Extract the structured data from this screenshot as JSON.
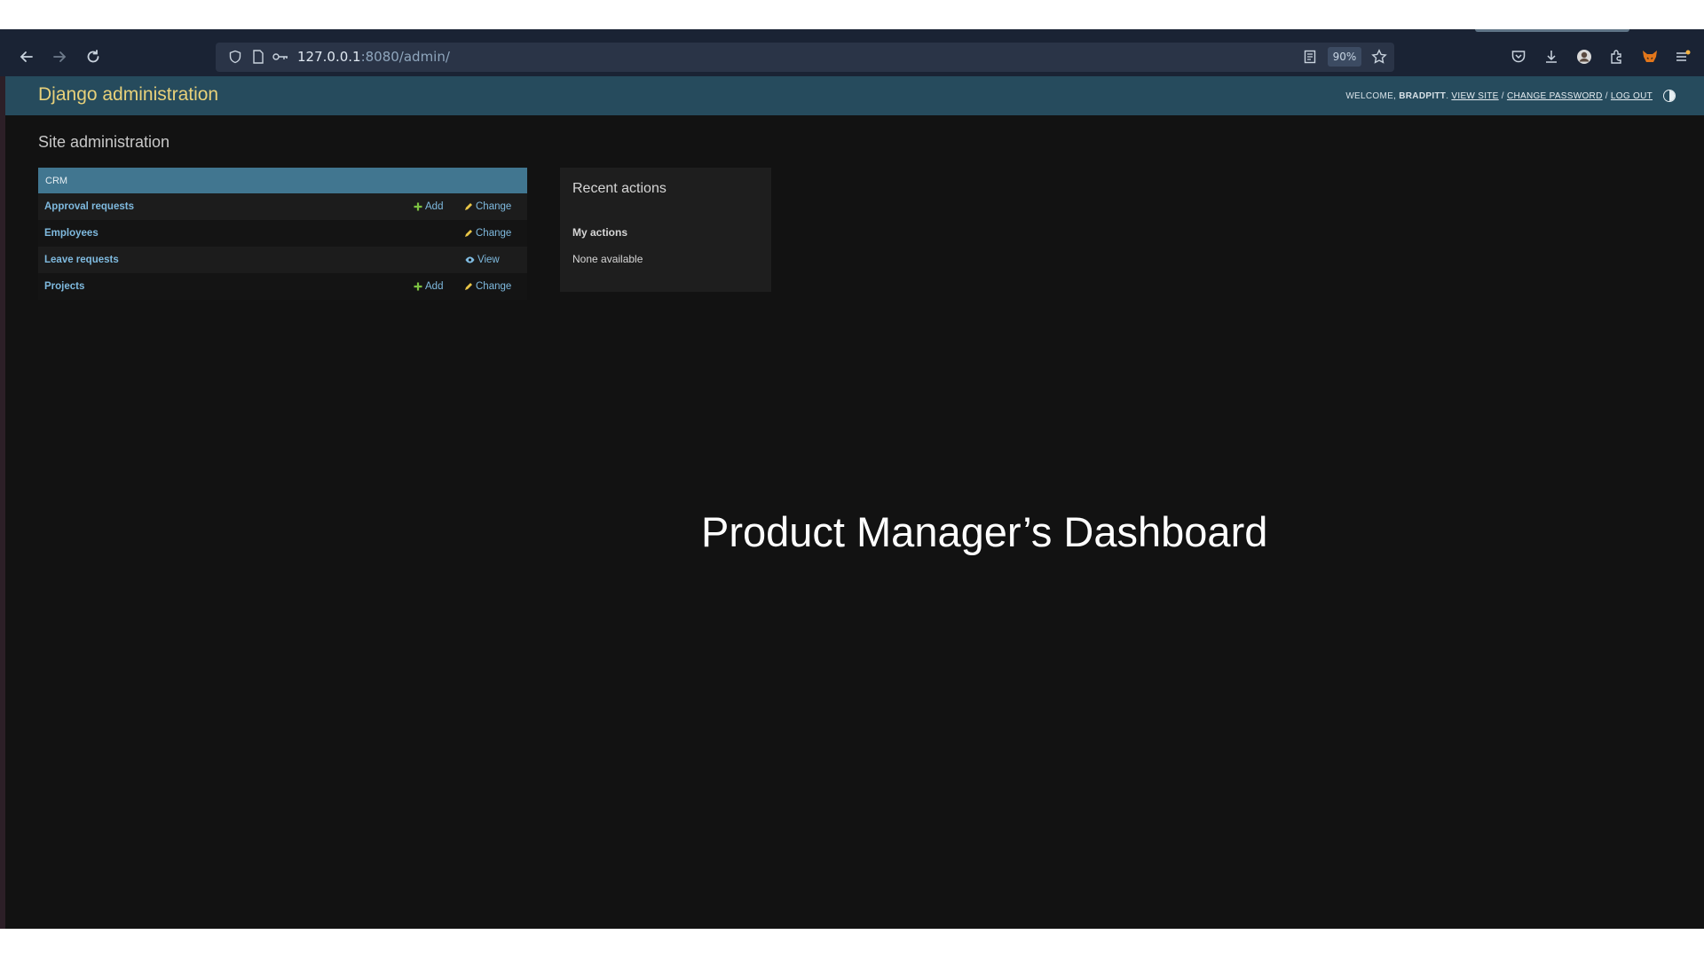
{
  "browser": {
    "url_host": "127.0.0.1",
    "url_path": ":8080/admin/",
    "zoom": "90%"
  },
  "header": {
    "branding": "Django administration",
    "welcome": "WELCOME,",
    "username": "BRADPITT",
    "view_site": "VIEW SITE",
    "change_password": "CHANGE PASSWORD",
    "log_out": "LOG OUT",
    "sep": "/"
  },
  "main": {
    "title": "Site administration"
  },
  "crm": {
    "caption": "CRM",
    "models": [
      {
        "name": "Approval requests",
        "add": "Add",
        "change": "Change"
      },
      {
        "name": "Employees",
        "change": "Change"
      },
      {
        "name": "Leave requests",
        "view": "View"
      },
      {
        "name": "Projects",
        "add": "Add",
        "change": "Change"
      }
    ]
  },
  "recent_actions": {
    "title": "Recent actions",
    "subtitle": "My actions",
    "empty": "None available"
  },
  "overlay": {
    "text": "Product Manager’s Dashboard"
  },
  "colors": {
    "header_bg": "#264b5d",
    "module_caption_bg": "#417690",
    "link": "#7fbadf",
    "branding": "#e8d17a",
    "add_icon": "#7cc142",
    "change_icon": "#e8c547",
    "view_icon": "#7fbadf"
  }
}
